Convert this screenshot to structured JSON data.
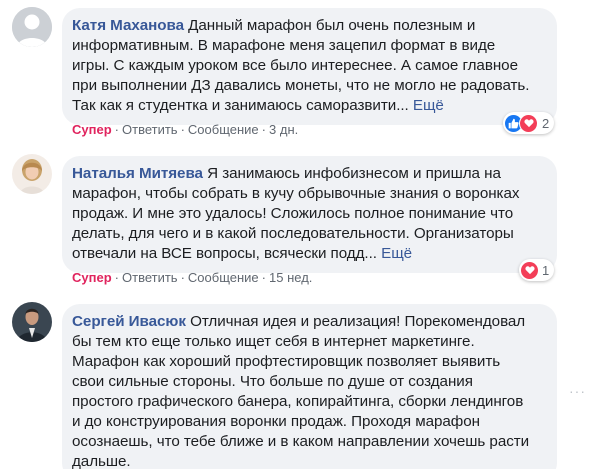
{
  "comments": [
    {
      "author": "Катя Маханова",
      "lines": [
        "Данный марафон был очень полезным и",
        "информативным. В марафоне меня зацепил формат в виде",
        "игры. С каждым уроком все было интереснее. А самое главное",
        "при выполнении ДЗ давались монеты, что не могло не радовать.",
        "Так как я студентка и занимаюсь саморазвити..."
      ],
      "more": "Ещё",
      "like_label": "Супер",
      "reply_label": "Ответить",
      "message_label": "Сообщение",
      "time": "3 дн.",
      "reaction_count": "2",
      "reactions": [
        "like-icon",
        "love-icon"
      ]
    },
    {
      "author": "Наталья Митяева",
      "lines": [
        "Я занимаюсь инфобизнесом и пришла на",
        "марафон, чтобы собрать в кучу обрывочные знания о воронках",
        "продаж. И мне это удалось! Сложилось полное понимание что",
        "делать, для чего и в какой последовательности. Организаторы",
        "отвечали на ВСЕ вопросы, всячески подд..."
      ],
      "more": "Ещё",
      "like_label": "Супер",
      "reply_label": "Ответить",
      "message_label": "Сообщение",
      "time": "15 нед.",
      "reaction_count": "1",
      "reactions": [
        "love-icon"
      ]
    },
    {
      "author": "Сергей Ивасюк",
      "lines": [
        "Отличная идея и реализация! Порекомендовал",
        "бы тем кто еще только ищет себя в интернет маркетинге.",
        "Марафон как хороший профтестировщик позволяет выявить",
        "свои сильные стороны. Что больше по душе от создания",
        "простого графического банера, копирайтинга, сборки лендингов",
        "и до конструирования воронки продаж. Проходя марафон",
        "осознаешь, что тебе ближе и в каком направлении хочешь расти",
        "дальше."
      ]
    }
  ],
  "separator": "·",
  "options_icon": "more-options-icon",
  "colors": {
    "author": "#385898",
    "bubble": "#f0f2f5",
    "super": "#e0245e",
    "like": "#1877f2",
    "love": "#f33e58",
    "meta": "#606770"
  }
}
